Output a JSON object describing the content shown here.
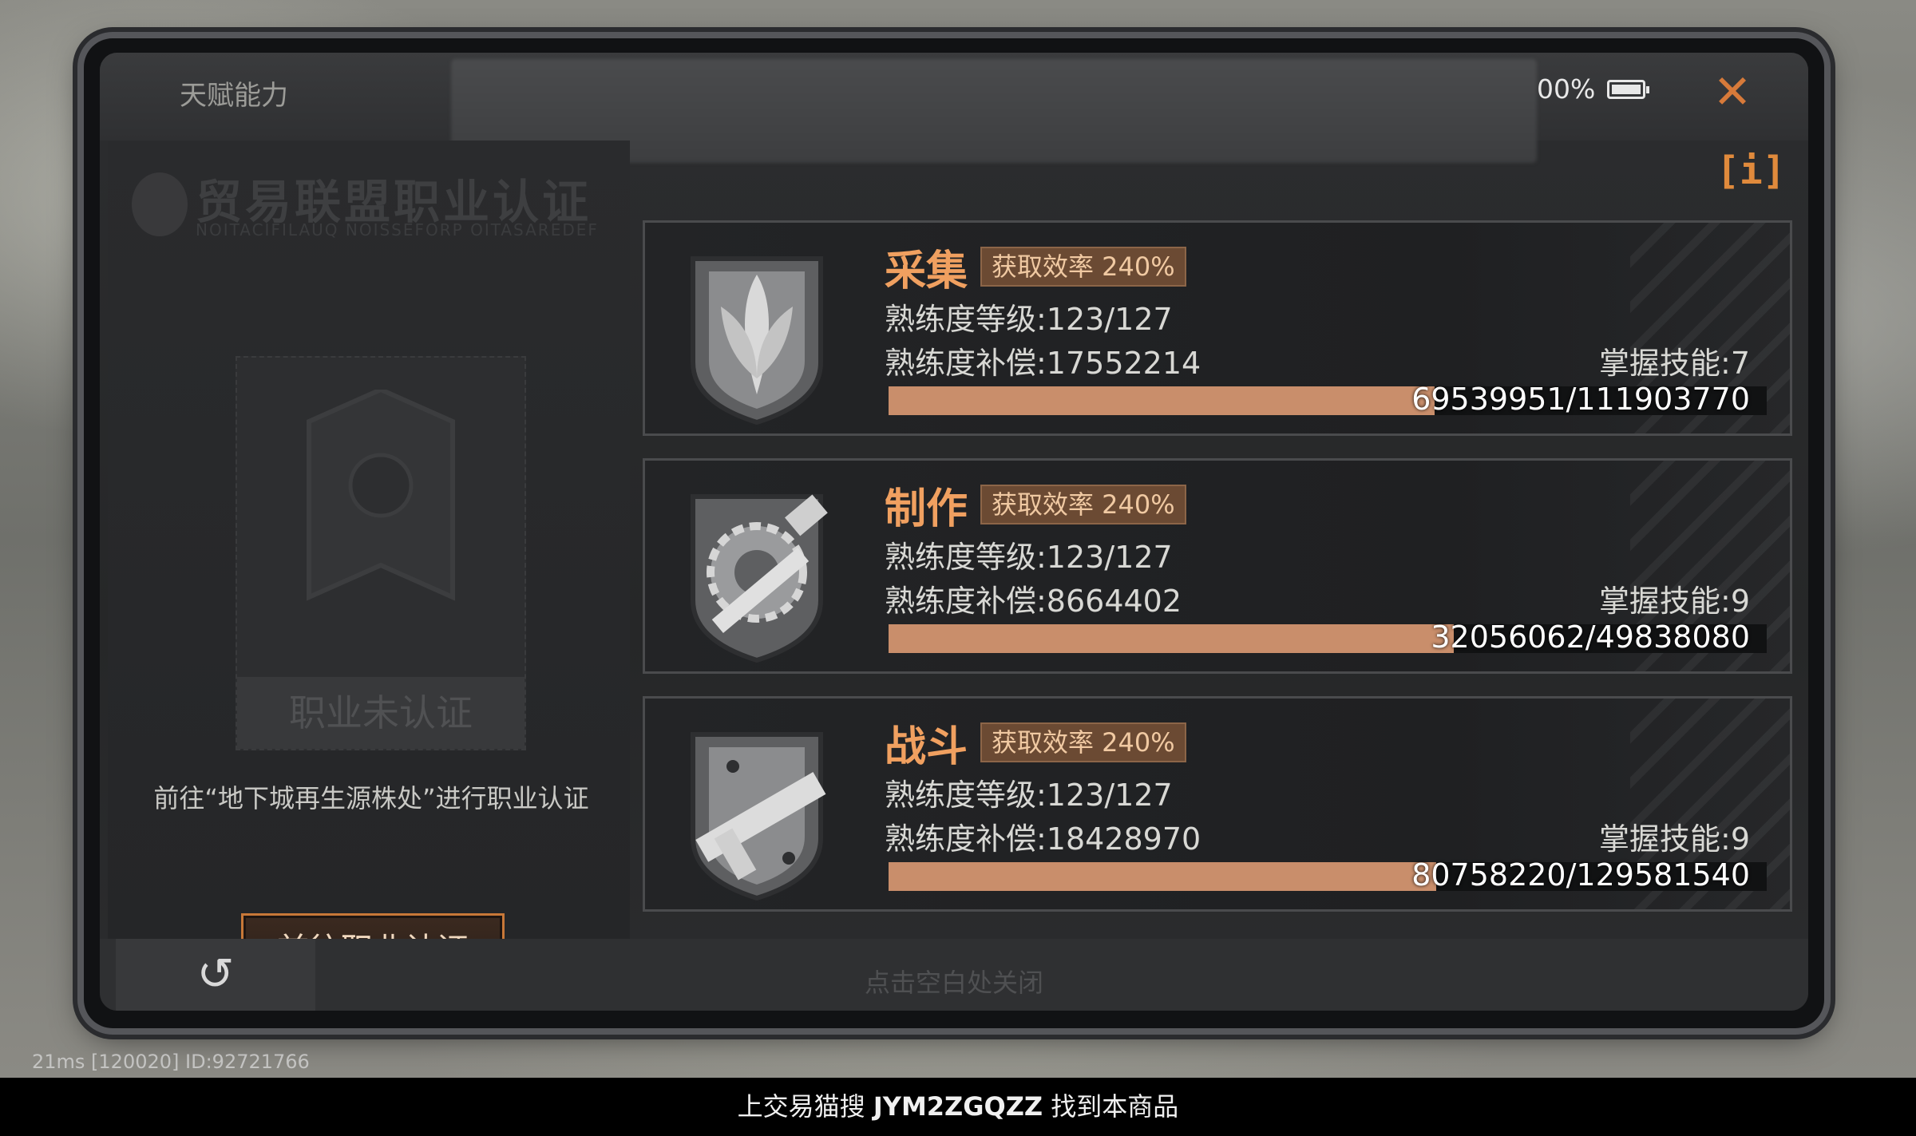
{
  "header": {
    "title": "天赋能力",
    "battery": "00%"
  },
  "left": {
    "cert_title": "贸易联盟职业认证",
    "cert_subtitle": "NOITACIFILAUQ NOISSEFORP OITASAREDEF",
    "uncertified": "职业未认证",
    "instruction": "前往“地下城再生源株处”进行职业认证",
    "goto_button": "前往职业认证"
  },
  "skills": [
    {
      "name": "采集",
      "efficiency": "获取效率 240%",
      "level": "熟练度等级:123/127",
      "compensation": "熟练度补偿:17552214",
      "mastered": "掌握技能:7",
      "progress_text": "69539951/111903770",
      "progress": 0.6214
    },
    {
      "name": "制作",
      "efficiency": "获取效率 240%",
      "level": "熟练度等级:123/127",
      "compensation": "熟练度补偿:8664402",
      "mastered": "掌握技能:9",
      "progress_text": "32056062/49838080",
      "progress": 0.6432
    },
    {
      "name": "战斗",
      "efficiency": "获取效率 240%",
      "level": "熟练度等级:123/127",
      "compensation": "熟练度补偿:18428970",
      "mastered": "掌握技能:9",
      "progress_text": "80758220/129581540",
      "progress": 0.6232
    }
  ],
  "footer": {
    "close_hint": "点击空白处关闭",
    "back_icon": "↺",
    "status": "21ms  [120020] ID:92721766"
  },
  "watermark": {
    "prefix": "上交易猫搜",
    "code": "JYM2ZGQZZ",
    "suffix": "找到本商品"
  },
  "colors": {
    "accent": "#d77a3a",
    "bar": "#c98e6b",
    "name": "#f0a060"
  }
}
